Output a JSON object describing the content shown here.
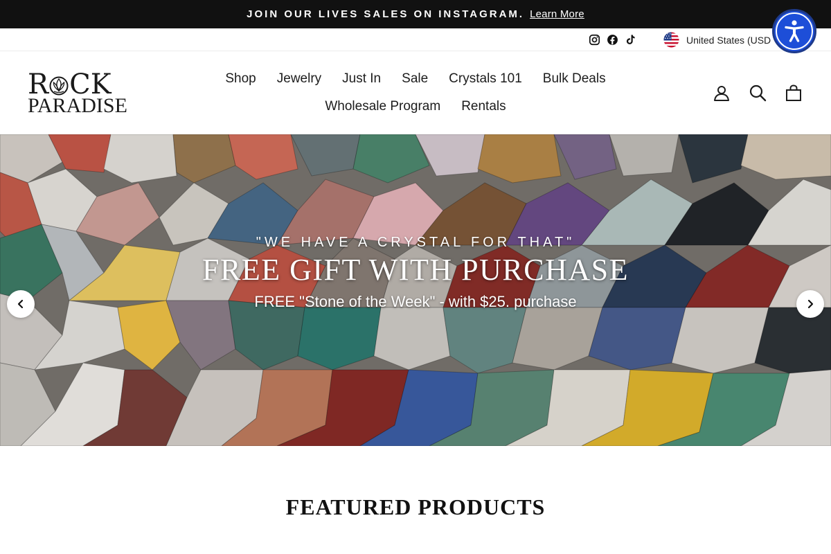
{
  "announcement": {
    "text": "JOIN OUR LIVES SALES ON INSTAGRAM.",
    "link": "Learn More"
  },
  "utility": {
    "social": [
      "instagram-icon",
      "facebook-icon",
      "tiktok-icon"
    ],
    "currency": "United States (USD"
  },
  "logo": {
    "line1_start": "R",
    "line1_end": "CK",
    "line2": "PARADISE"
  },
  "nav": {
    "items": [
      "Shop",
      "Jewelry",
      "Just In",
      "Sale",
      "Crystals 101",
      "Bulk Deals",
      "Wholesale Program",
      "Rentals"
    ]
  },
  "header_icons": [
    "account-icon",
    "search-icon",
    "cart-icon"
  ],
  "hero": {
    "kicker": "\"WE HAVE A CRYSTAL FOR THAT\"",
    "title": "FREE GIFT WITH PURCHASE",
    "subtitle": "FREE \"Stone of the Week\" - with $25. purchase"
  },
  "featured": {
    "title": "FEATURED PRODUCTS"
  },
  "colors": {
    "announcement_bg": "#111111",
    "accessibility_blue": "#1d4ed8",
    "text": "#1c1c1c"
  }
}
